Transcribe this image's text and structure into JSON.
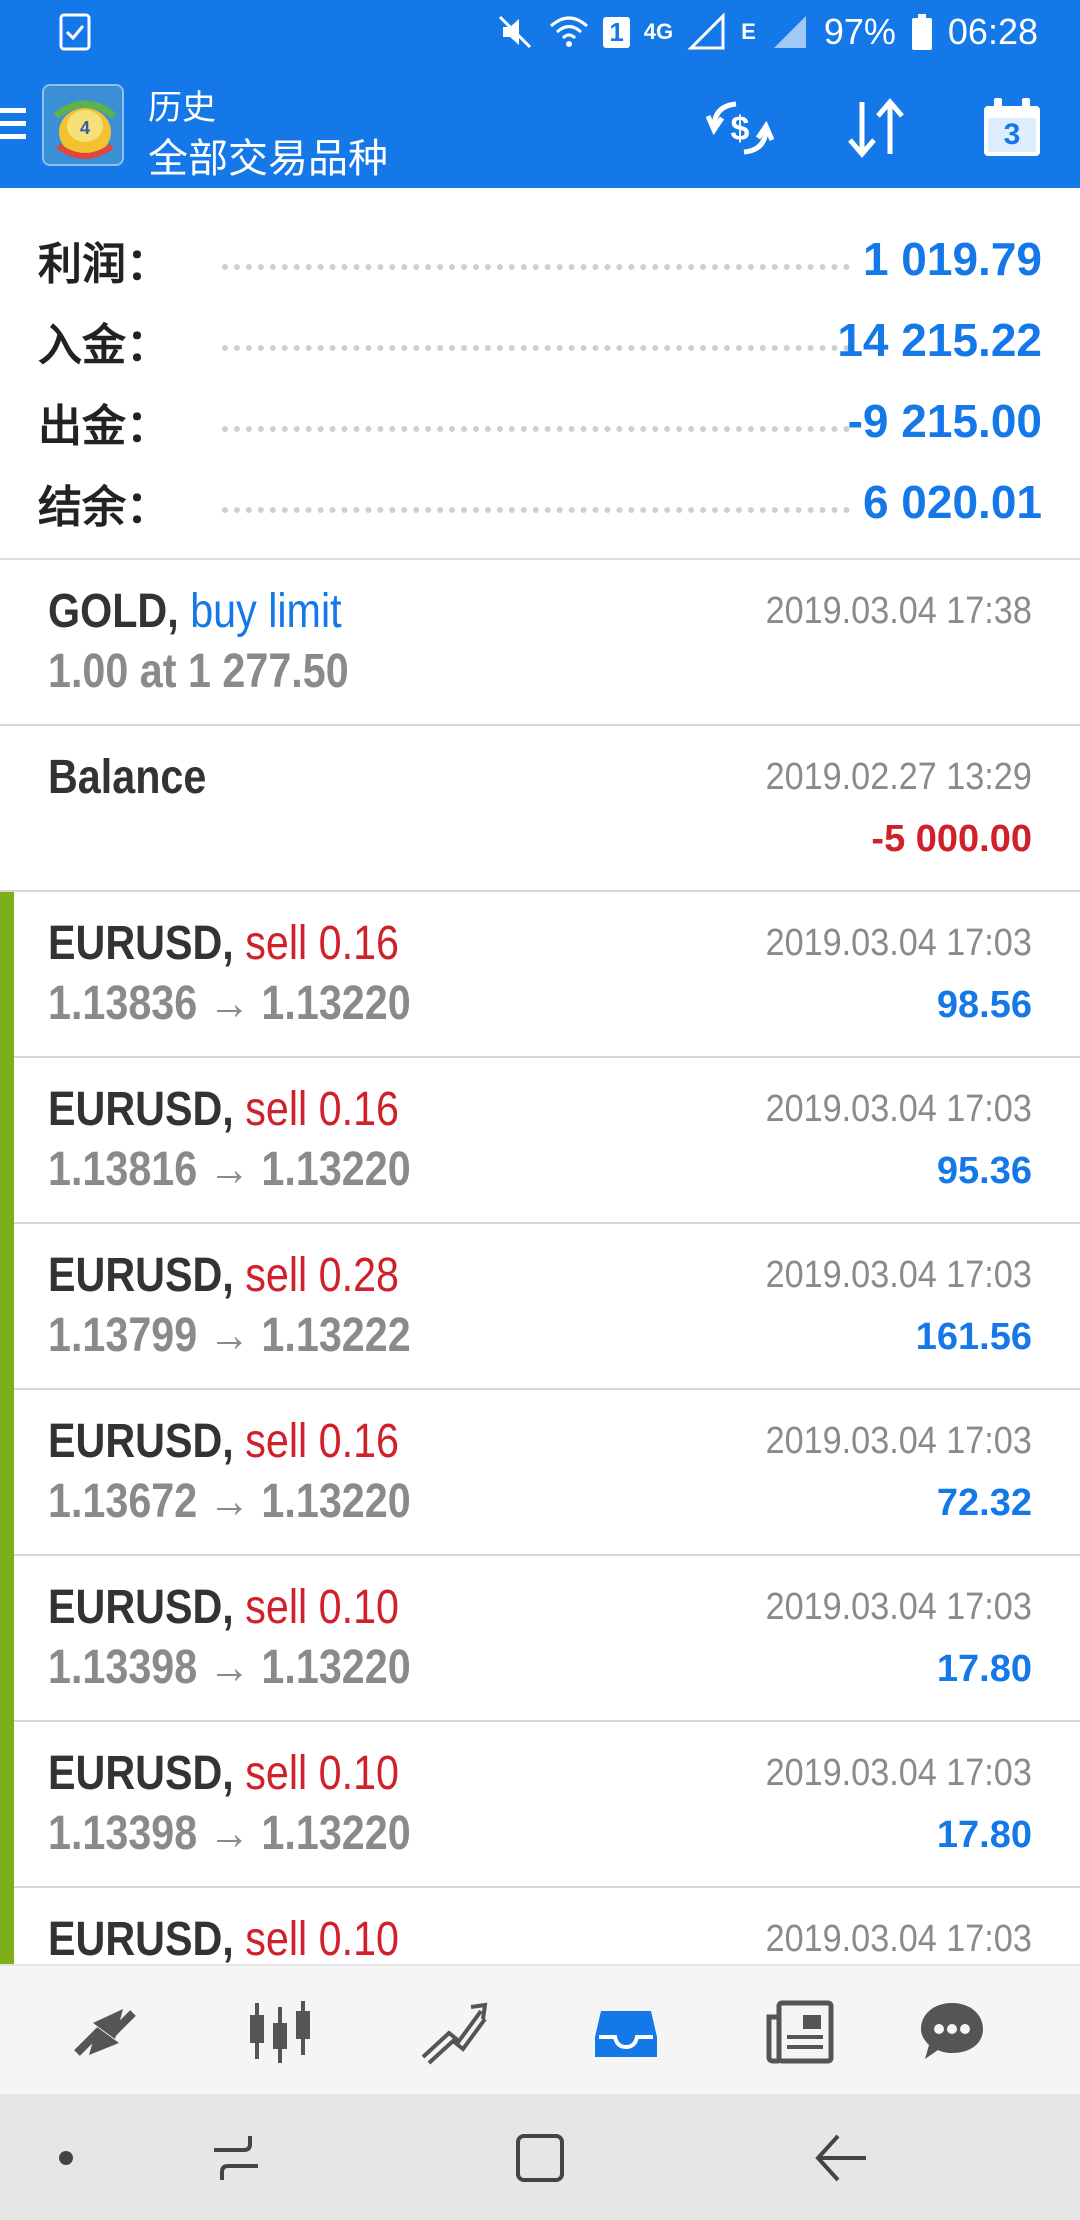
{
  "status_bar": {
    "battery": "97%",
    "time": "06:28",
    "network": "4G",
    "sim_badge": "1",
    "signal_letter": "E"
  },
  "app_bar": {
    "title_small": "历史",
    "title_big": "全部交易品种",
    "calendar_day": "3",
    "accent": "#1478e8"
  },
  "summary": [
    {
      "label": "利润：",
      "value": "1 019.79"
    },
    {
      "label": "入金：",
      "value": "14 215.22"
    },
    {
      "label": "出金：",
      "value": "-9 215.00"
    },
    {
      "label": "结余：",
      "value": "6 020.01"
    }
  ],
  "records": [
    {
      "symbol": "GOLD,",
      "action": " buy limit",
      "action_color": "blue",
      "line2": "1.00 at 1 277.50",
      "datetime": "2019.03.04 17:38",
      "profit": "",
      "profit_color": "blue",
      "stripe": false
    },
    {
      "symbol": "Balance",
      "action": "",
      "action_color": "blue",
      "line2": "",
      "datetime": "2019.02.27 13:29",
      "profit": "-5 000.00",
      "profit_color": "red",
      "stripe": false
    },
    {
      "symbol": "EURUSD,",
      "action": " sell 0.16",
      "action_color": "red",
      "line2": "1.13836 → 1.13220",
      "datetime": "2019.03.04 17:03",
      "profit": "98.56",
      "profit_color": "blue",
      "stripe": true
    },
    {
      "symbol": "EURUSD,",
      "action": " sell 0.16",
      "action_color": "red",
      "line2": "1.13816 → 1.13220",
      "datetime": "2019.03.04 17:03",
      "profit": "95.36",
      "profit_color": "blue",
      "stripe": true
    },
    {
      "symbol": "EURUSD,",
      "action": " sell 0.28",
      "action_color": "red",
      "line2": "1.13799 → 1.13222",
      "datetime": "2019.03.04 17:03",
      "profit": "161.56",
      "profit_color": "blue",
      "stripe": true
    },
    {
      "symbol": "EURUSD,",
      "action": " sell 0.16",
      "action_color": "red",
      "line2": "1.13672 → 1.13220",
      "datetime": "2019.03.04 17:03",
      "profit": "72.32",
      "profit_color": "blue",
      "stripe": true
    },
    {
      "symbol": "EURUSD,",
      "action": " sell 0.10",
      "action_color": "red",
      "line2": "1.13398 → 1.13220",
      "datetime": "2019.03.04 17:03",
      "profit": "17.80",
      "profit_color": "blue",
      "stripe": true
    },
    {
      "symbol": "EURUSD,",
      "action": " sell 0.10",
      "action_color": "red",
      "line2": "1.13398 → 1.13220",
      "datetime": "2019.03.04 17:03",
      "profit": "17.80",
      "profit_color": "blue",
      "stripe": true
    },
    {
      "symbol": "EURUSD,",
      "action": " sell 0.10",
      "action_color": "red",
      "line2": "",
      "datetime": "2019.03.04 17:03",
      "profit": "",
      "profit_color": "blue",
      "stripe": true
    }
  ],
  "bottom_nav": [
    {
      "icon": "quotes-icon",
      "active": false
    },
    {
      "icon": "chart-icon",
      "active": false
    },
    {
      "icon": "trade-icon",
      "active": false
    },
    {
      "icon": "history-icon",
      "active": true
    },
    {
      "icon": "news-icon",
      "active": false
    },
    {
      "icon": "chat-icon",
      "active": false
    }
  ],
  "colors": {
    "positive": "#1478e8",
    "negative": "#d0202a",
    "stripe": "#7db018"
  }
}
